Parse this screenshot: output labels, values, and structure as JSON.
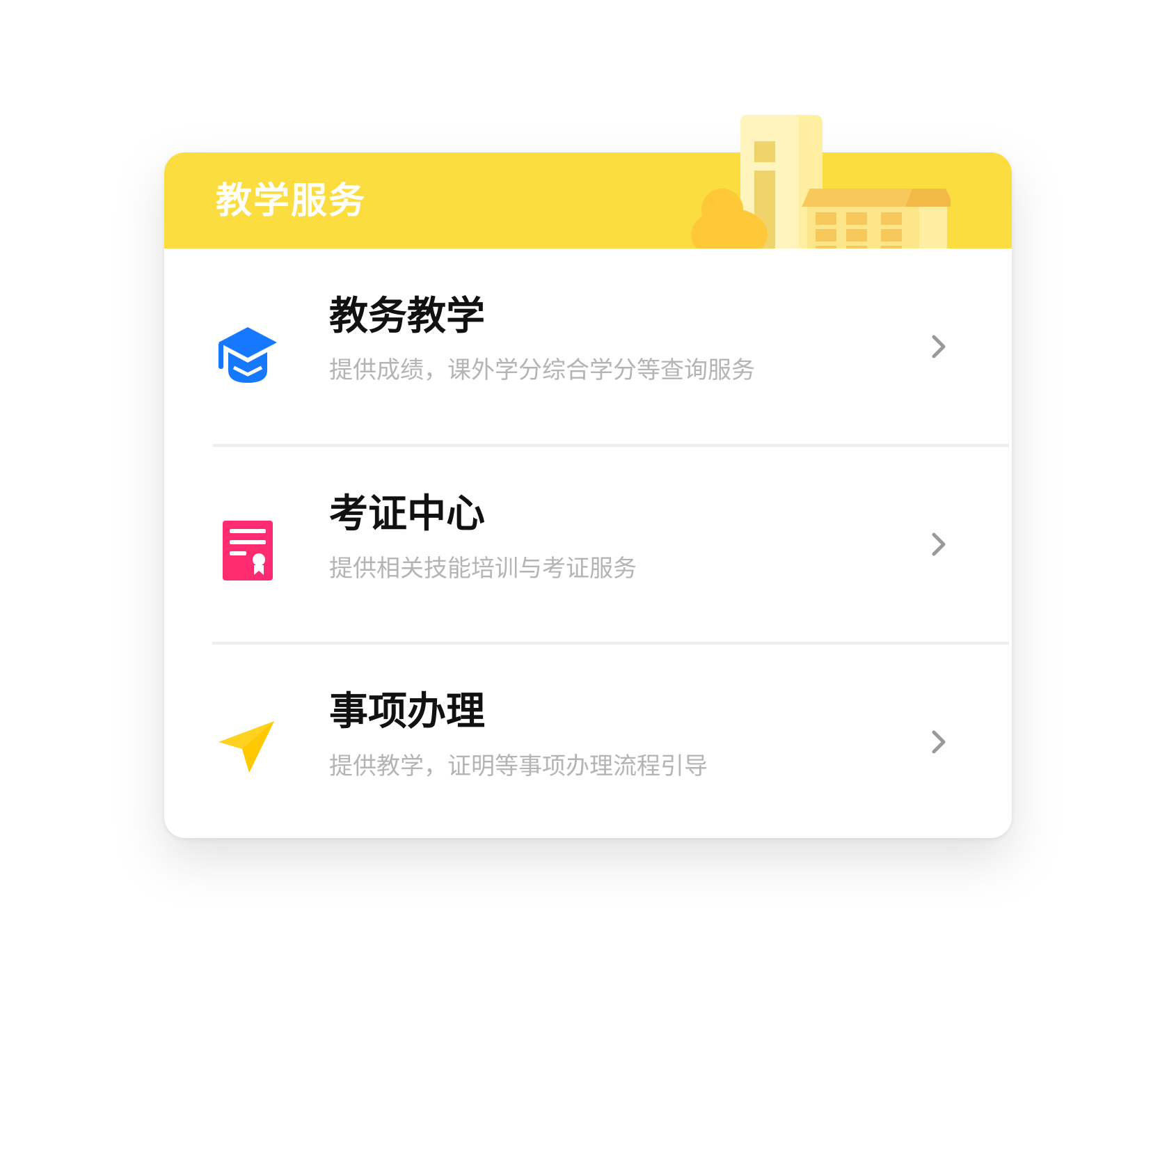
{
  "card": {
    "title": "教学服务",
    "header_color": "#FCDD3F",
    "illustration": "campus-buildings-icon"
  },
  "items": [
    {
      "title": "教务教学",
      "description": "提供成绩，课外学分综合学分等查询服务",
      "icon": "graduation-cap-icon",
      "icon_color": "#1677FF"
    },
    {
      "title": "考证中心",
      "description": "提供相关技能培训与考证服务",
      "icon": "certificate-icon",
      "icon_color": "#FF2B70"
    },
    {
      "title": "事项办理",
      "description": "提供教学，证明等事项办理流程引导",
      "icon": "paper-plane-icon",
      "icon_color": "#FFD21F"
    }
  ],
  "chevron_icon": "chevron-right-icon",
  "colors": {
    "title_text": "#111111",
    "description_text": "#B4B4B4",
    "chevron": "#999999",
    "divider": "#EEEEEE"
  }
}
